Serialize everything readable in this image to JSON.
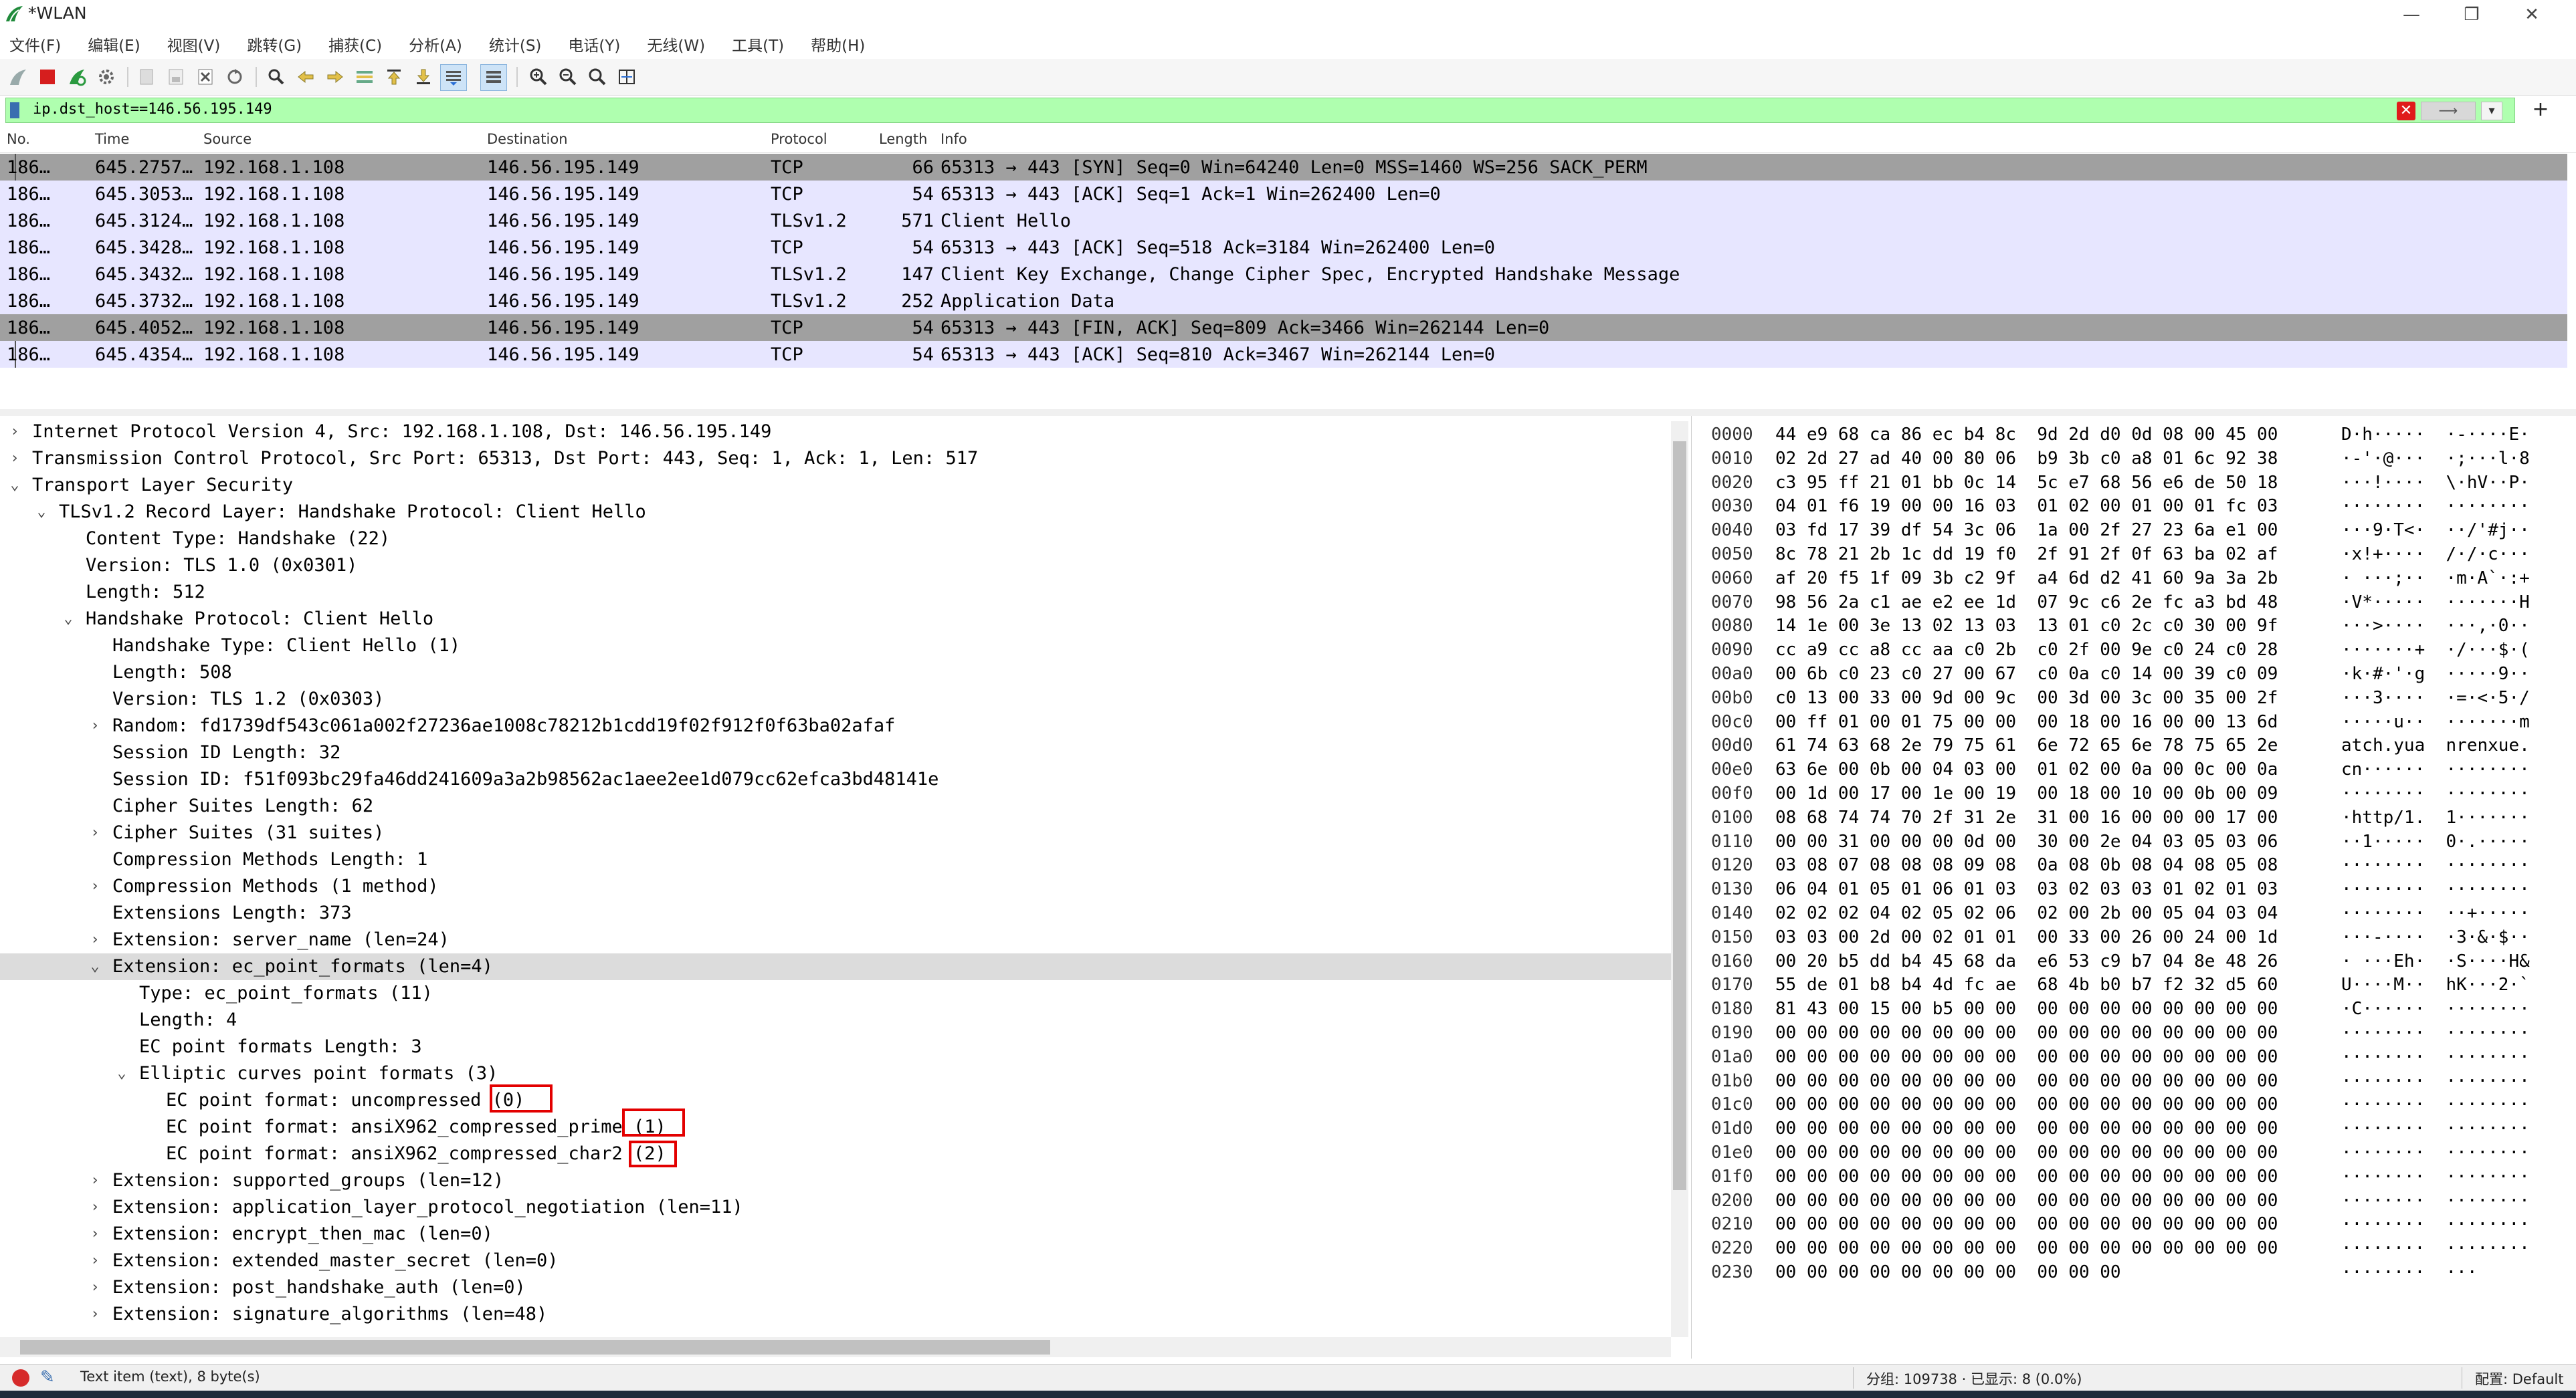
{
  "window": {
    "title": "*WLAN"
  },
  "menu": [
    "文件(F)",
    "编辑(E)",
    "视图(V)",
    "跳转(G)",
    "捕获(C)",
    "分析(A)",
    "统计(S)",
    "电话(Y)",
    "无线(W)",
    "工具(T)",
    "帮助(H)"
  ],
  "filter": {
    "value": "ip.dst_host==146.56.195.149",
    "apply_label": "⟶"
  },
  "packet_list": {
    "columns": [
      "No.",
      "Time",
      "Source",
      "Destination",
      "Protocol",
      "Length",
      "Info"
    ],
    "rows": [
      {
        "no": "186…",
        "time": "645.2757…",
        "source": "192.168.1.108",
        "destination": "146.56.195.149",
        "protocol": "TCP",
        "length": "66",
        "info": "65313 → 443 [SYN] Seq=0 Win=64240 Len=0 MSS=1460 WS=256 SACK_PERM",
        "style": "sel"
      },
      {
        "no": "186…",
        "time": "645.3053…",
        "source": "192.168.1.108",
        "destination": "146.56.195.149",
        "protocol": "TCP",
        "length": "54",
        "info": "65313 → 443 [ACK] Seq=1 Ack=1 Win=262400 Len=0",
        "style": "tcp"
      },
      {
        "no": "186…",
        "time": "645.3124…",
        "source": "192.168.1.108",
        "destination": "146.56.195.149",
        "protocol": "TLSv1.2",
        "length": "571",
        "info": "Client Hello",
        "style": "tcp"
      },
      {
        "no": "186…",
        "time": "645.3428…",
        "source": "192.168.1.108",
        "destination": "146.56.195.149",
        "protocol": "TCP",
        "length": "54",
        "info": "65313 → 443 [ACK] Seq=518 Ack=3184 Win=262400 Len=0",
        "style": "tcp"
      },
      {
        "no": "186…",
        "time": "645.3432…",
        "source": "192.168.1.108",
        "destination": "146.56.195.149",
        "protocol": "TLSv1.2",
        "length": "147",
        "info": "Client Key Exchange, Change Cipher Spec, Encrypted Handshake Message",
        "style": "tcp"
      },
      {
        "no": "186…",
        "time": "645.3732…",
        "source": "192.168.1.108",
        "destination": "146.56.195.149",
        "protocol": "TLSv1.2",
        "length": "252",
        "info": "Application Data",
        "style": "tcp"
      },
      {
        "no": "186…",
        "time": "645.4052…",
        "source": "192.168.1.108",
        "destination": "146.56.195.149",
        "protocol": "TCP",
        "length": "54",
        "info": "65313 → 443 [FIN, ACK] Seq=809 Ack=3466 Win=262144 Len=0",
        "style": "sel"
      },
      {
        "no": "186…",
        "time": "645.4354…",
        "source": "192.168.1.108",
        "destination": "146.56.195.149",
        "protocol": "TCP",
        "length": "54",
        "info": "65313 → 443 [ACK] Seq=810 Ack=3467 Win=262144 Len=0",
        "style": "tcp"
      }
    ]
  },
  "details": [
    {
      "depth": 0,
      "toggle": "closed",
      "text": "Internet Protocol Version 4, Src: 192.168.1.108, Dst: 146.56.195.149"
    },
    {
      "depth": 0,
      "toggle": "closed",
      "text": "Transmission Control Protocol, Src Port: 65313, Dst Port: 443, Seq: 1, Ack: 1, Len: 517"
    },
    {
      "depth": 0,
      "toggle": "open",
      "text": "Transport Layer Security"
    },
    {
      "depth": 1,
      "toggle": "open",
      "text": "TLSv1.2 Record Layer: Handshake Protocol: Client Hello"
    },
    {
      "depth": 2,
      "toggle": "none",
      "text": "Content Type: Handshake (22)"
    },
    {
      "depth": 2,
      "toggle": "none",
      "text": "Version: TLS 1.0 (0x0301)"
    },
    {
      "depth": 2,
      "toggle": "none",
      "text": "Length: 512"
    },
    {
      "depth": 2,
      "toggle": "open",
      "text": "Handshake Protocol: Client Hello"
    },
    {
      "depth": 3,
      "toggle": "none",
      "text": "Handshake Type: Client Hello (1)"
    },
    {
      "depth": 3,
      "toggle": "none",
      "text": "Length: 508"
    },
    {
      "depth": 3,
      "toggle": "none",
      "text": "Version: TLS 1.2 (0x0303)"
    },
    {
      "depth": 3,
      "toggle": "closed",
      "text": "Random: fd1739df543c061a002f27236ae1008c78212b1cdd19f02f912f0f63ba02afaf"
    },
    {
      "depth": 3,
      "toggle": "none",
      "text": "Session ID Length: 32"
    },
    {
      "depth": 3,
      "toggle": "none",
      "text": "Session ID: f51f093bc29fa46dd241609a3a2b98562ac1aee2ee1d079cc62efca3bd48141e"
    },
    {
      "depth": 3,
      "toggle": "none",
      "text": "Cipher Suites Length: 62"
    },
    {
      "depth": 3,
      "toggle": "closed",
      "text": "Cipher Suites (31 suites)"
    },
    {
      "depth": 3,
      "toggle": "none",
      "text": "Compression Methods Length: 1"
    },
    {
      "depth": 3,
      "toggle": "closed",
      "text": "Compression Methods (1 method)"
    },
    {
      "depth": 3,
      "toggle": "none",
      "text": "Extensions Length: 373"
    },
    {
      "depth": 3,
      "toggle": "closed",
      "text": "Extension: server_name (len=24)"
    },
    {
      "depth": 3,
      "toggle": "open",
      "text": "Extension: ec_point_formats (len=4)",
      "selected": true
    },
    {
      "depth": 4,
      "toggle": "none",
      "text": "Type: ec_point_formats (11)"
    },
    {
      "depth": 4,
      "toggle": "none",
      "text": "Length: 4"
    },
    {
      "depth": 4,
      "toggle": "none",
      "text": "EC point formats Length: 3"
    },
    {
      "depth": 4,
      "toggle": "open",
      "text": "Elliptic curves point formats (3)"
    },
    {
      "depth": 5,
      "toggle": "none",
      "text": "EC point format: uncompressed (0)"
    },
    {
      "depth": 5,
      "toggle": "none",
      "text": "EC point format: ansiX962_compressed_prime (1)"
    },
    {
      "depth": 5,
      "toggle": "none",
      "text": "EC point format: ansiX962_compressed_char2 (2)"
    },
    {
      "depth": 3,
      "toggle": "closed",
      "text": "Extension: supported_groups (len=12)"
    },
    {
      "depth": 3,
      "toggle": "closed",
      "text": "Extension: application_layer_protocol_negotiation (len=11)"
    },
    {
      "depth": 3,
      "toggle": "closed",
      "text": "Extension: encrypt_then_mac (len=0)"
    },
    {
      "depth": 3,
      "toggle": "closed",
      "text": "Extension: extended_master_secret (len=0)"
    },
    {
      "depth": 3,
      "toggle": "closed",
      "text": "Extension: post_handshake_auth (len=0)"
    },
    {
      "depth": 3,
      "toggle": "closed",
      "text": "Extension: signature_algorithms (len=48)"
    }
  ],
  "bytes": [
    {
      "offset": "0000",
      "hex": "44 e9 68 ca 86 ec b4 8c  9d 2d d0 0d 08 00 45 00",
      "ascii": "D·h·····  ·-····E·"
    },
    {
      "offset": "0010",
      "hex": "02 2d 27 ad 40 00 80 06  b9 3b c0 a8 01 6c 92 38",
      "ascii": "·-'·@···  ·;···l·8"
    },
    {
      "offset": "0020",
      "hex": "c3 95 ff 21 01 bb 0c 14  5c e7 68 56 e6 de 50 18",
      "ascii": "···!····  \\·hV··P·"
    },
    {
      "offset": "0030",
      "hex": "04 01 f6 19 00 00 16 03  01 02 00 01 00 01 fc 03",
      "ascii": "········  ········"
    },
    {
      "offset": "0040",
      "hex": "03 fd 17 39 df 54 3c 06  1a 00 2f 27 23 6a e1 00",
      "ascii": "···9·T<·  ··/'#j··"
    },
    {
      "offset": "0050",
      "hex": "8c 78 21 2b 1c dd 19 f0  2f 91 2f 0f 63 ba 02 af",
      "ascii": "·x!+····  /·/·c···"
    },
    {
      "offset": "0060",
      "hex": "af 20 f5 1f 09 3b c2 9f  a4 6d d2 41 60 9a 3a 2b",
      "ascii": "· ···;··  ·m·A`·:+"
    },
    {
      "offset": "0070",
      "hex": "98 56 2a c1 ae e2 ee 1d  07 9c c6 2e fc a3 bd 48",
      "ascii": "·V*·····  ·······H"
    },
    {
      "offset": "0080",
      "hex": "14 1e 00 3e 13 02 13 03  13 01 c0 2c c0 30 00 9f",
      "ascii": "···>····  ···,·0··"
    },
    {
      "offset": "0090",
      "hex": "cc a9 cc a8 cc aa c0 2b  c0 2f 00 9e c0 24 c0 28",
      "ascii": "·······+  ·/···$·("
    },
    {
      "offset": "00a0",
      "hex": "00 6b c0 23 c0 27 00 67  c0 0a c0 14 00 39 c0 09",
      "ascii": "·k·#·'·g  ·····9··"
    },
    {
      "offset": "00b0",
      "hex": "c0 13 00 33 00 9d 00 9c  00 3d 00 3c 00 35 00 2f",
      "ascii": "···3····  ·=·<·5·/"
    },
    {
      "offset": "00c0",
      "hex": "00 ff 01 00 01 75 00 00  00 18 00 16 00 00 13 6d",
      "ascii": "·····u··  ·······m"
    },
    {
      "offset": "00d0",
      "hex": "61 74 63 68 2e 79 75 61  6e 72 65 6e 78 75 65 2e",
      "ascii": "atch.yua  nrenxue."
    },
    {
      "offset": "00e0",
      "hex": "63 6e 00 0b 00 04 03 00  01 02 00 0a 00 0c 00 0a",
      "ascii": "cn······  ········"
    },
    {
      "offset": "00f0",
      "hex": "00 1d 00 17 00 1e 00 19  00 18 00 10 00 0b 00 09",
      "ascii": "········  ········"
    },
    {
      "offset": "0100",
      "hex": "08 68 74 74 70 2f 31 2e  31 00 16 00 00 00 17 00",
      "ascii": "·http/1.  1·······"
    },
    {
      "offset": "0110",
      "hex": "00 00 31 00 00 00 0d 00  30 00 2e 04 03 05 03 06",
      "ascii": "··1·····  0·.·····"
    },
    {
      "offset": "0120",
      "hex": "03 08 07 08 08 08 09 08  0a 08 0b 08 04 08 05 08",
      "ascii": "········  ········"
    },
    {
      "offset": "0130",
      "hex": "06 04 01 05 01 06 01 03  03 02 03 03 01 02 01 03",
      "ascii": "········  ········"
    },
    {
      "offset": "0140",
      "hex": "02 02 02 04 02 05 02 06  02 00 2b 00 05 04 03 04",
      "ascii": "········  ··+·····"
    },
    {
      "offset": "0150",
      "hex": "03 03 00 2d 00 02 01 01  00 33 00 26 00 24 00 1d",
      "ascii": "···-····  ·3·&·$··"
    },
    {
      "offset": "0160",
      "hex": "00 20 b5 dd b4 45 68 da  e6 53 c9 b7 04 8e 48 26",
      "ascii": "· ···Eh·  ·S····H&"
    },
    {
      "offset": "0170",
      "hex": "55 de 01 b8 b4 4d fc ae  68 4b b0 b7 f2 32 d5 60",
      "ascii": "U····M··  hK···2·`"
    },
    {
      "offset": "0180",
      "hex": "81 43 00 15 00 b5 00 00  00 00 00 00 00 00 00 00",
      "ascii": "·C······  ········"
    },
    {
      "offset": "0190",
      "hex": "00 00 00 00 00 00 00 00  00 00 00 00 00 00 00 00",
      "ascii": "········  ········"
    },
    {
      "offset": "01a0",
      "hex": "00 00 00 00 00 00 00 00  00 00 00 00 00 00 00 00",
      "ascii": "········  ········"
    },
    {
      "offset": "01b0",
      "hex": "00 00 00 00 00 00 00 00  00 00 00 00 00 00 00 00",
      "ascii": "········  ········"
    },
    {
      "offset": "01c0",
      "hex": "00 00 00 00 00 00 00 00  00 00 00 00 00 00 00 00",
      "ascii": "········  ········"
    },
    {
      "offset": "01d0",
      "hex": "00 00 00 00 00 00 00 00  00 00 00 00 00 00 00 00",
      "ascii": "········  ········"
    },
    {
      "offset": "01e0",
      "hex": "00 00 00 00 00 00 00 00  00 00 00 00 00 00 00 00",
      "ascii": "········  ········"
    },
    {
      "offset": "01f0",
      "hex": "00 00 00 00 00 00 00 00  00 00 00 00 00 00 00 00",
      "ascii": "········  ········"
    },
    {
      "offset": "0200",
      "hex": "00 00 00 00 00 00 00 00  00 00 00 00 00 00 00 00",
      "ascii": "········  ········"
    },
    {
      "offset": "0210",
      "hex": "00 00 00 00 00 00 00 00  00 00 00 00 00 00 00 00",
      "ascii": "········  ········"
    },
    {
      "offset": "0220",
      "hex": "00 00 00 00 00 00 00 00  00 00 00 00 00 00 00 00",
      "ascii": "········  ········"
    },
    {
      "offset": "0230",
      "hex": "00 00 00 00 00 00 00 00  00 00 00",
      "ascii": "········  ···"
    }
  ],
  "status": {
    "field_info": "Text item (text), 8 byte(s)",
    "counts": "分组: 109738 · 已显示: 8 (0.0%)",
    "profile": "配置: Default"
  },
  "colors": {
    "filter_valid": "#afffaf",
    "tcp_row": "#e7e6ff",
    "selected_row": "#a0a0a0",
    "highlight_box": "#e30000"
  }
}
